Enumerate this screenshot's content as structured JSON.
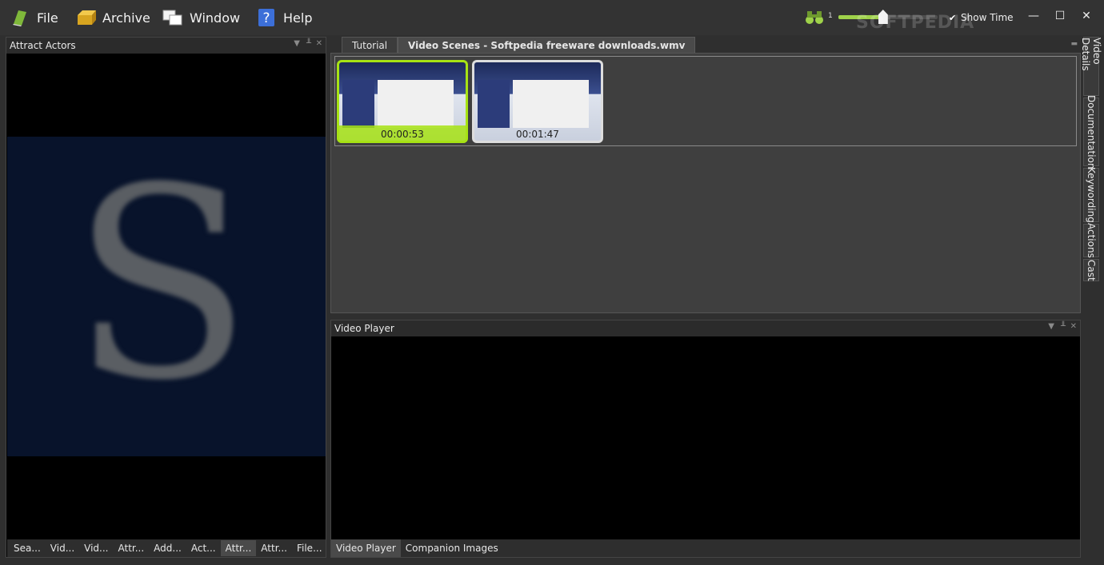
{
  "menubar": {
    "items": [
      {
        "label": "File",
        "icon": "book-icon"
      },
      {
        "label": "Archive",
        "icon": "archive-box-icon"
      },
      {
        "label": "Window",
        "icon": "windows-icon"
      },
      {
        "label": "Help",
        "icon": "help-question-icon"
      }
    ],
    "zoom": {
      "value_label": "1",
      "level": 0.45
    },
    "watermark": "SOFTPEDIA",
    "show_time": {
      "label": "Show Time",
      "checked": true
    }
  },
  "left_panel": {
    "title": "Attract Actors",
    "tabs": [
      "Sea...",
      "Vid...",
      "Vid...",
      "Attr...",
      "Add...",
      "Act...",
      "Attr...",
      "Attr...",
      "File..."
    ],
    "active_tab": 6
  },
  "documents": {
    "tabs": [
      "Tutorial",
      "Video Scenes - Softpedia freeware downloads.wmv"
    ],
    "active_tab": 1,
    "scenes": [
      {
        "time": "00:00:53",
        "selected": true
      },
      {
        "time": "00:01:47",
        "selected": false
      }
    ]
  },
  "right_tabs": [
    "Video Details",
    "Documentation",
    "Keywording",
    "Actions",
    "Cast"
  ],
  "player_panel": {
    "title": "Video Player",
    "tabs": [
      "Video Player",
      "Companion Images"
    ],
    "active_tab": 0
  },
  "colors": {
    "accent": "#a7e314",
    "background": "#2f2f2f"
  }
}
